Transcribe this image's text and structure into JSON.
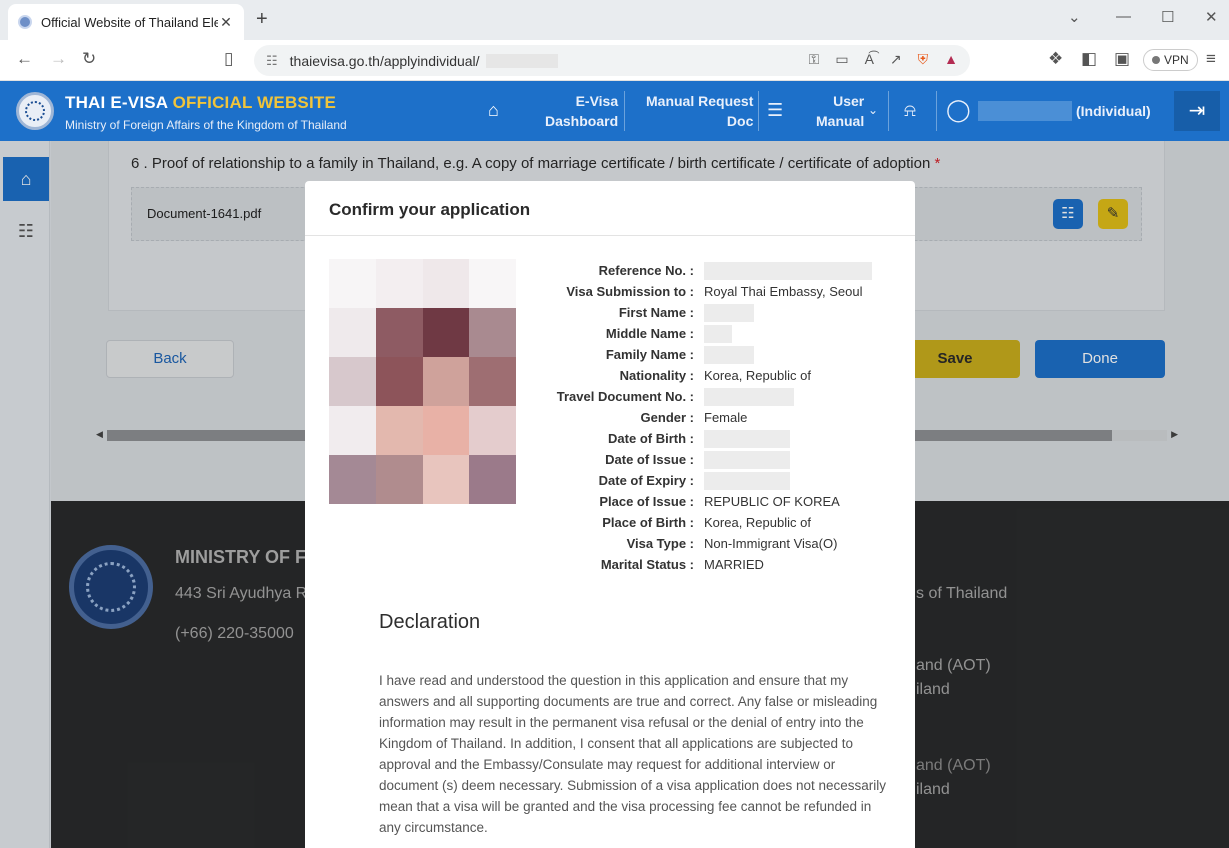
{
  "browser": {
    "tab_title": "Official Website of Thailand Ele",
    "url": "thaievisa.go.th/applyindividual/",
    "vpn_label": "VPN"
  },
  "site": {
    "title_main": "THAI E-VISA ",
    "title_accent": "OFFICIAL WEBSITE",
    "subtitle": "Ministry of Foreign Affairs of the Kingdom of Thailand",
    "nav": {
      "dashboard_l1": "E-Visa",
      "dashboard_l2": "Dashboard",
      "manual_l1": "Manual Request",
      "manual_l2": "Doc",
      "user_l1": "User",
      "user_l2": "Manual",
      "user_role": "(Individual)"
    },
    "accent_color": "#1d70c9",
    "gold_color": "#f0c43b"
  },
  "page": {
    "question": "6 . Proof of relationship to a family in Thailand, e.g. A copy of marriage certificate / birth certificate / certificate of adoption",
    "required_mark": "*",
    "document_name": "Document-1641.pdf",
    "back_label": "Back",
    "save_label": "Save",
    "done_label": "Done"
  },
  "footer": {
    "title": "MINISTRY OF F",
    "address": "443 Sri Ayudhya Ro",
    "phone": "(+66) 220-35000",
    "right1": "s of Thailand",
    "right2": "and (AOT)",
    "right3": "iland",
    "right4": "and (AOT)",
    "right5": "iland"
  },
  "modal": {
    "title": "Confirm your application",
    "fields": [
      {
        "label": "Reference No. :",
        "value": ""
      },
      {
        "label": "Visa Submission to :",
        "value": "Royal Thai Embassy, Seoul"
      },
      {
        "label": "First Name :",
        "value": ""
      },
      {
        "label": "Middle Name :",
        "value": ""
      },
      {
        "label": "Family Name :",
        "value": ""
      },
      {
        "label": "Nationality :",
        "value": "Korea, Republic of"
      },
      {
        "label": "Travel Document No. :",
        "value": ""
      },
      {
        "label": "Gender :",
        "value": "Female"
      },
      {
        "label": "Date of Birth :",
        "value": ""
      },
      {
        "label": "Date of Issue :",
        "value": ""
      },
      {
        "label": "Date of Expiry :",
        "value": ""
      },
      {
        "label": "Place of Issue :",
        "value": "REPUBLIC OF KOREA"
      },
      {
        "label": "Place of Birth :",
        "value": "Korea, Republic of"
      },
      {
        "label": "Visa Type :",
        "value": "Non-Immigrant Visa(O)"
      },
      {
        "label": "Marital Status :",
        "value": "MARRIED"
      }
    ],
    "declaration_title": "Declaration",
    "declaration_text": "I have read and understood the question in this application and ensure that my answers and all supporting documents are true and correct. Any false or misleading information may result in the permanent visa refusal or the denial of entry into the Kingdom of Thailand. In addition, I consent that all applications are subjected to approval and the Embassy/Consulate may request for additional interview or document (s) deem necessary. Submission of a visa application does not necessarily mean that a visa will be granted and the visa processing fee cannot be refunded in any circumstance."
  }
}
